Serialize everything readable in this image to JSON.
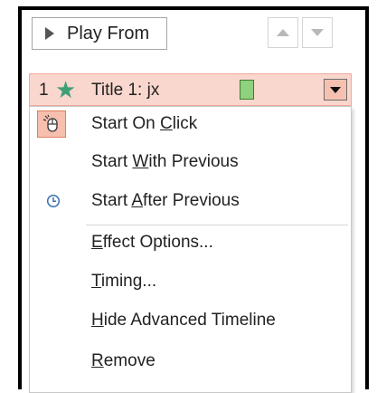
{
  "toolbar": {
    "play_from_label": "Play From",
    "move_up_icon": "triangle-up-icon",
    "move_down_icon": "triangle-down-icon"
  },
  "animation_item": {
    "number": "1",
    "effect_icon": "star-icon",
    "title": "Title 1: jx",
    "timing_bar_color": "#8fd17c",
    "dropdown_icon": "triangle-down-icon"
  },
  "menu": {
    "items": [
      {
        "pre": "Start On ",
        "key": "C",
        "post": "lick",
        "icon": "mouse-click-icon",
        "selected": true
      },
      {
        "pre": "Start ",
        "key": "W",
        "post": "ith Previous",
        "icon": "",
        "selected": false
      },
      {
        "pre": "Start ",
        "key": "A",
        "post": "fter Previous",
        "icon": "clock-icon",
        "selected": false
      },
      {
        "pre": "",
        "key": "E",
        "post": "ffect Options...",
        "icon": "",
        "selected": false
      },
      {
        "pre": "",
        "key": "T",
        "post": "iming...",
        "icon": "",
        "selected": false
      },
      {
        "pre": "",
        "key": "H",
        "post": "ide Advanced Timeline",
        "icon": "",
        "selected": false
      },
      {
        "pre": "",
        "key": "R",
        "post": "emove",
        "icon": "",
        "selected": false
      }
    ]
  },
  "colors": {
    "selection_bg": "#fad7ce",
    "selection_border": "#f0a898",
    "star": "#3f9f75",
    "clock": "#3b6fb0"
  }
}
